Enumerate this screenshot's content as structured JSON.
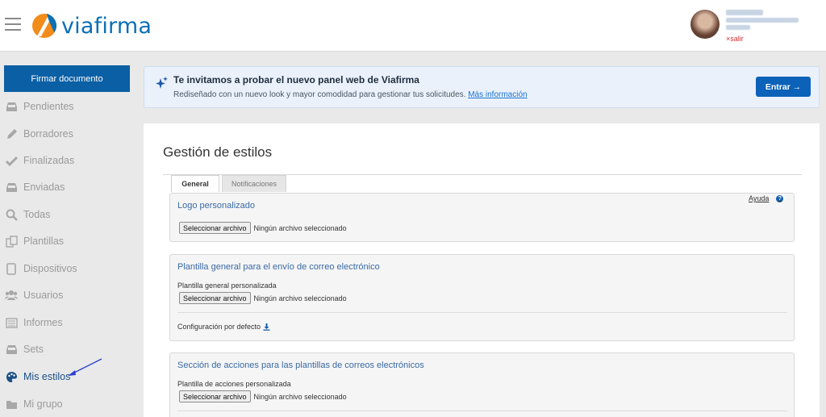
{
  "header": {
    "brand": "viafirma",
    "logout_label": "salir",
    "colors": {
      "brand_blue": "#0b6fb3",
      "brand_orange": "#f28c1b"
    }
  },
  "sidebar": {
    "sign_button": "Firmar documento",
    "items": [
      {
        "label": "Pendientes",
        "icon": "inbox-icon"
      },
      {
        "label": "Borradores",
        "icon": "pencil-icon"
      },
      {
        "label": "Finalizadas",
        "icon": "check-icon"
      },
      {
        "label": "Enviadas",
        "icon": "inbox-icon"
      },
      {
        "label": "Todas",
        "icon": "search-icon"
      },
      {
        "label": "Plantillas",
        "icon": "templates-icon"
      },
      {
        "label": "Dispositivos",
        "icon": "tablet-icon"
      },
      {
        "label": "Usuarios",
        "icon": "users-icon"
      },
      {
        "label": "Informes",
        "icon": "report-icon"
      },
      {
        "label": "Sets",
        "icon": "inbox-icon"
      },
      {
        "label": "Mis estilos",
        "icon": "palette-icon",
        "active": true
      },
      {
        "label": "Mi grupo",
        "icon": "folder-icon"
      }
    ]
  },
  "banner": {
    "title": "Te invitamos a probar el nuevo panel web de Viafirma",
    "text": "Rediseñado con un nuevo look y mayor comodidad para gestionar tus solicitudes.",
    "link": "Más información",
    "button": "Entrar →"
  },
  "main": {
    "title": "Gestión de estilos",
    "tabs": [
      "General",
      "Notificaciones"
    ],
    "help": "Ayuda",
    "panels": [
      {
        "title": "Logo personalizado",
        "file_button": "Seleccionar archivo",
        "file_status": "Ningún archivo seleccionado"
      },
      {
        "title": "Plantilla general para el envío de correo electrónico",
        "sub_label": "Plantilla general personalizada",
        "file_button": "Seleccionar archivo",
        "file_status": "Ningún archivo seleccionado",
        "default_config": "Configuración por defecto"
      },
      {
        "title": "Sección de acciones para las plantillas de correos electrónicos",
        "sub_label": "Plantilla de acciones personalizada",
        "file_button": "Seleccionar archivo",
        "file_status": "Ningún archivo seleccionado"
      }
    ]
  }
}
